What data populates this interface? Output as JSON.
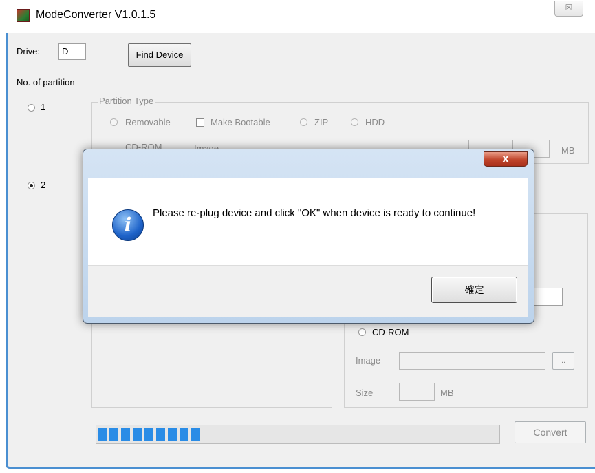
{
  "window": {
    "title": "ModeConverter V1.0.1.5",
    "close_glyph": "☒",
    "icon": "app-tree-icon"
  },
  "drive": {
    "label": "Drive:",
    "value": "D",
    "find_button": "Find Device"
  },
  "partition": {
    "heading": "No. of partition",
    "option_1": "1",
    "option_2": "2",
    "selected": "2"
  },
  "partition_type_top": {
    "title": "Partition Type",
    "removable": "Removable",
    "make_bootable": "Make Bootable",
    "zip": "ZIP",
    "hdd": "HDD",
    "cdrom": "CD-ROM",
    "image_label": "Image",
    "size_unit": "MB"
  },
  "partition_right": {
    "cdrom": "CD-ROM",
    "image_label": "Image",
    "browse": "..",
    "size_label": "Size",
    "size_unit": "MB"
  },
  "progress": {
    "fraction": 0.27,
    "segments": 9
  },
  "convert_button": "Convert",
  "dialog": {
    "close_glyph": "x",
    "icon": "info-icon",
    "message": "Please re-plug device and click \"OK\" when device is ready to continue!",
    "ok_button": "確定"
  },
  "colors": {
    "progress": "#2a8ce6",
    "window_border": "#4a8fd1",
    "dialog_close": "#c0452c"
  }
}
